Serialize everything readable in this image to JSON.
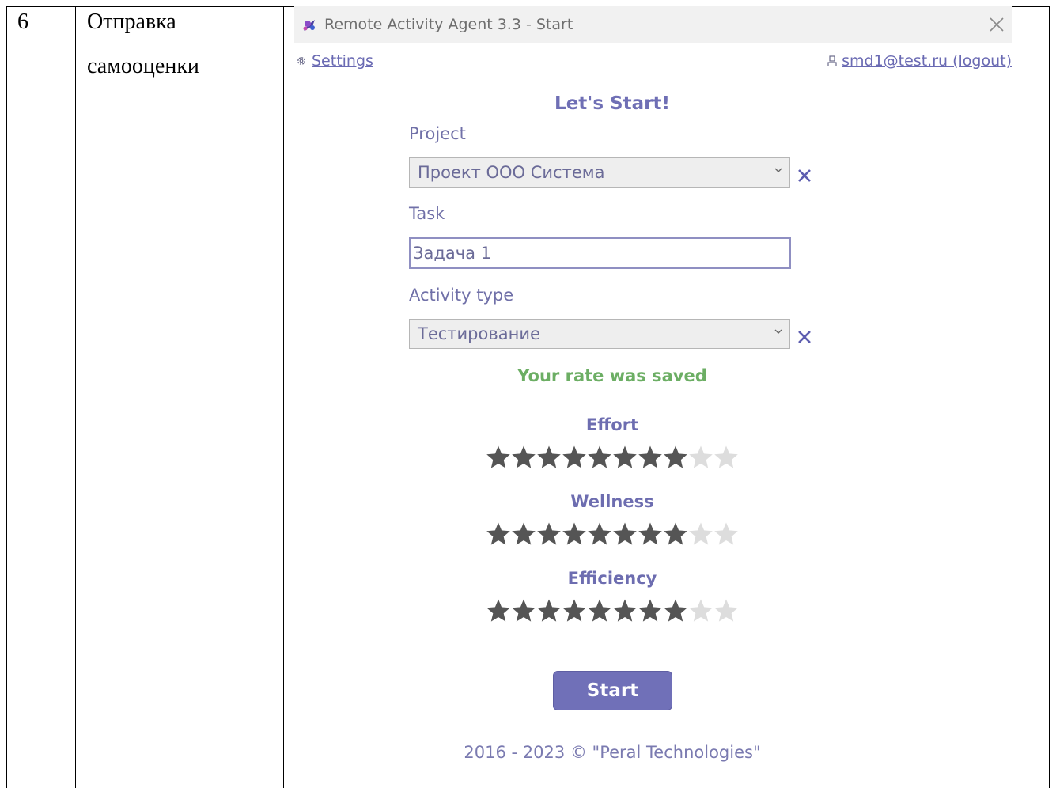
{
  "table": {
    "row_number": "6",
    "step_name_line1": "Отправка",
    "step_name_line2": "самооценки"
  },
  "window": {
    "title": "Remote Activity Agent 3.3 - Start",
    "settings_label": "Settings",
    "user_label": "smd1@test.ru (logout)",
    "heading": "Let's Start!",
    "project": {
      "label": "Project",
      "value": "Проект ООО Система"
    },
    "task": {
      "label": "Task",
      "value": "Задача 1"
    },
    "activity": {
      "label": "Activity type",
      "value": "Тестирование"
    },
    "status_message": "Your rate was saved",
    "ratings": [
      {
        "label": "Effort",
        "value": 8,
        "max": 10
      },
      {
        "label": "Wellness",
        "value": 8,
        "max": 10
      },
      {
        "label": "Efficiency",
        "value": 8,
        "max": 10
      }
    ],
    "start_label": "Start",
    "footer": "2016 - 2023 © \"Peral Technologies\""
  },
  "colors": {
    "accent": "#7070b8",
    "status_green": "#6cae64",
    "star_filled": "#555555",
    "star_empty": "#dddddd"
  },
  "icons": [
    "app-logo-icon",
    "close-icon",
    "gear-icon",
    "user-icon",
    "chevron-down-icon",
    "clear-icon",
    "star-icon"
  ]
}
